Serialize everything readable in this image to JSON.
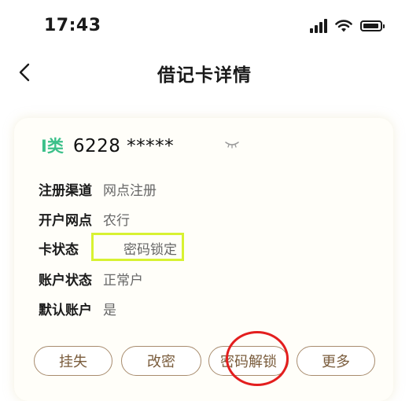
{
  "status_bar": {
    "time": "17:43"
  },
  "nav": {
    "title": "借记卡详情",
    "back_icon": "chevron-left-icon"
  },
  "card": {
    "class_badge": "I类",
    "card_number": "6228 *****",
    "rows": [
      {
        "label": "注册渠道",
        "value": "网点注册"
      },
      {
        "label": "开户网点",
        "value": "农行"
      },
      {
        "label": "卡状态",
        "value": "密码锁定"
      },
      {
        "label": "账户状态",
        "value": "正常户"
      },
      {
        "label": "默认账户",
        "value": "是"
      }
    ]
  },
  "actions": {
    "report_loss": "挂失",
    "change_password": "改密",
    "unlock_password": "密码解锁",
    "more": "更多"
  },
  "colors": {
    "accent_green": "#3cc08a",
    "button_brown": "#7a5c3c",
    "highlight_box": "#d8f232",
    "annotation_red": "#e31e1e"
  }
}
